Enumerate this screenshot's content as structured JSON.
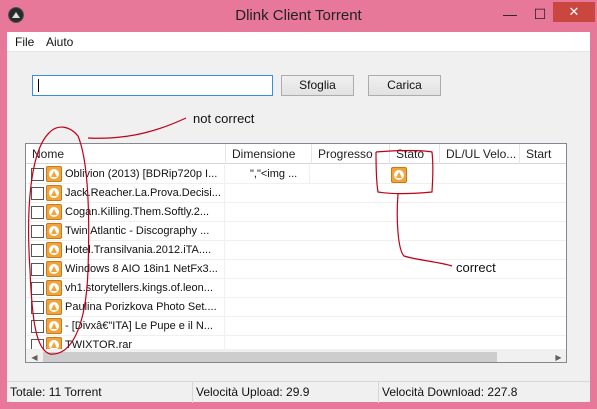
{
  "window": {
    "title": "Dlink Client Torrent",
    "minimize": "—",
    "maximize": "☐",
    "close": "✕"
  },
  "menu": {
    "items": [
      "File",
      "Aiuto"
    ]
  },
  "toolbar": {
    "path_value": "",
    "browse_label": "Sfoglia",
    "load_label": "Carica"
  },
  "table": {
    "columns": [
      "Nome",
      "Dimensione",
      "Progresso",
      "Stato",
      "DL/UL Velo...",
      "Start"
    ],
    "rows": [
      {
        "name": "Oblivion (2013) [BDRip720p I...",
        "size": "\",\"<img ...",
        "status_icon": "arrow-up-circle-icon"
      },
      {
        "name": "Jack.Reacher.La.Prova.Decisi...",
        "size": ""
      },
      {
        "name": "Cogan.Killing.Them.Softly.2...",
        "size": ""
      },
      {
        "name": "Twin Atlantic - Discography ...",
        "size": ""
      },
      {
        "name": "Hotel.Transilvania.2012.iTA....",
        "size": ""
      },
      {
        "name": "Windows 8 AIO 18in1 NetFx3...",
        "size": ""
      },
      {
        "name": "vh1.storytellers.kings.of.leon...",
        "size": ""
      },
      {
        "name": "Paulina Porizkova Photo Set....",
        "size": ""
      },
      {
        "name": "- [Divxâ€\"ITA] Le Pupe e il N...",
        "size": ""
      },
      {
        "name": "TWIXTOR.rar",
        "size": ""
      }
    ]
  },
  "statusbar": {
    "total": "Totale: 11 Torrent",
    "upload": "Velocità Upload: 29.9",
    "download": "Velocità Download: 227.8"
  },
  "annotations": {
    "not_correct": "not correct",
    "correct": "correct",
    "color": "#c0001a"
  }
}
